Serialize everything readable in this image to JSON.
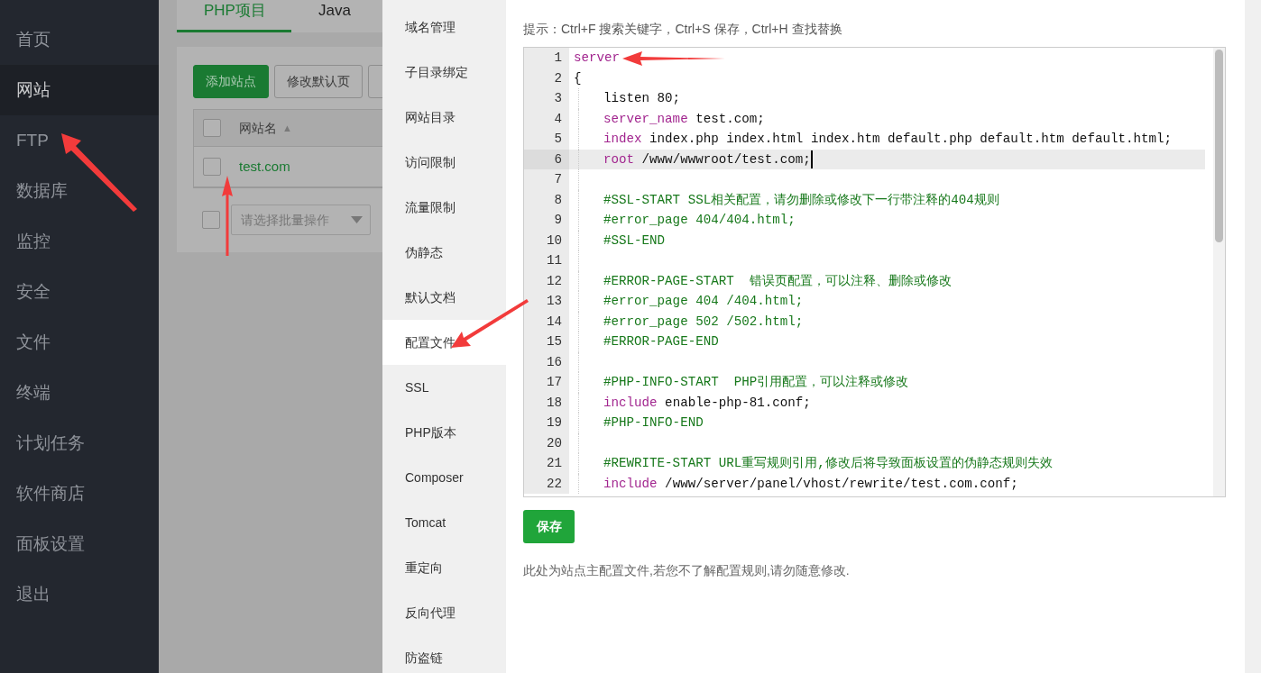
{
  "sidebar": {
    "items": [
      {
        "label": "首页",
        "selected": false
      },
      {
        "label": "网站",
        "selected": true
      },
      {
        "label": "FTP",
        "selected": false
      },
      {
        "label": "数据库",
        "selected": false
      },
      {
        "label": "监控",
        "selected": false
      },
      {
        "label": "安全",
        "selected": false
      },
      {
        "label": "文件",
        "selected": false
      },
      {
        "label": "终端",
        "selected": false
      },
      {
        "label": "计划任务",
        "selected": false
      },
      {
        "label": "软件商店",
        "selected": false
      },
      {
        "label": "面板设置",
        "selected": false
      },
      {
        "label": "退出",
        "selected": false
      }
    ]
  },
  "background_page": {
    "tabs": [
      {
        "label": "PHP项目",
        "selected": true
      },
      {
        "label": "Java",
        "selected": false
      }
    ],
    "buttons": [
      {
        "label": "添加站点",
        "kind": "primary"
      },
      {
        "label": "修改默认页",
        "kind": "outline"
      },
      {
        "kind": "outline"
      }
    ],
    "table": {
      "header": {
        "label": "网站名",
        "sort_arrow": "▲",
        "checked": false
      },
      "rows": [
        {
          "name": "test.com",
          "checked": false
        }
      ]
    },
    "batch_select": {
      "placeholder": "请选择批量操作",
      "checked": false
    }
  },
  "dialog": {
    "menu": [
      {
        "label": "域名管理",
        "selected": false
      },
      {
        "label": "子目录绑定",
        "selected": false
      },
      {
        "label": "网站目录",
        "selected": false
      },
      {
        "label": "访问限制",
        "selected": false
      },
      {
        "label": "流量限制",
        "selected": false
      },
      {
        "label": "伪静态",
        "selected": false
      },
      {
        "label": "默认文档",
        "selected": false
      },
      {
        "label": "配置文件",
        "selected": true
      },
      {
        "label": "SSL",
        "selected": false
      },
      {
        "label": "PHP版本",
        "selected": false
      },
      {
        "label": "Composer",
        "selected": false
      },
      {
        "label": "Tomcat",
        "selected": false
      },
      {
        "label": "重定向",
        "selected": false
      },
      {
        "label": "反向代理",
        "selected": false
      },
      {
        "label": "防盗链",
        "selected": false
      }
    ],
    "hint": "提示：Ctrl+F 搜索关键字，Ctrl+S 保存，Ctrl+H 查找替换",
    "editor": {
      "lines": [
        {
          "number": "1",
          "indented": false,
          "current": false,
          "tokens": [
            {
              "text": "server",
              "kind": "keyword"
            }
          ]
        },
        {
          "number": "2",
          "indented": false,
          "current": false,
          "tokens": [
            {
              "text": "{",
              "kind": "plain"
            }
          ]
        },
        {
          "number": "3",
          "indented": true,
          "current": false,
          "tokens": [
            {
              "text": "listen 80;",
              "kind": "plain"
            }
          ]
        },
        {
          "number": "4",
          "indented": true,
          "current": false,
          "tokens": [
            {
              "text": "server_name",
              "kind": "keyword"
            },
            {
              "text": " test.com;",
              "kind": "plain"
            }
          ]
        },
        {
          "number": "5",
          "indented": true,
          "current": false,
          "tokens": [
            {
              "text": "index",
              "kind": "keyword"
            },
            {
              "text": " index.php index.html index.htm default.php default.htm default.html;",
              "kind": "plain"
            }
          ]
        },
        {
          "number": "6",
          "indented": true,
          "current": true,
          "tokens": [
            {
              "text": "root",
              "kind": "keyword"
            },
            {
              "text": " /www/wwwroot/test.com;",
              "kind": "plain"
            }
          ]
        },
        {
          "number": "7",
          "indented": true,
          "current": false
        },
        {
          "number": "8",
          "indented": true,
          "current": false,
          "tokens": [
            {
              "text": "#SSL-START SSL相关配置，请勿删除或修改下一行带注释的404规则",
              "kind": "comment"
            }
          ]
        },
        {
          "number": "9",
          "indented": true,
          "current": false,
          "tokens": [
            {
              "text": "#error_page 404/404.html;",
              "kind": "comment"
            }
          ]
        },
        {
          "number": "10",
          "indented": true,
          "current": false,
          "tokens": [
            {
              "text": "#SSL-END",
              "kind": "comment"
            }
          ]
        },
        {
          "number": "11",
          "indented": true,
          "current": false
        },
        {
          "number": "12",
          "indented": true,
          "current": false,
          "tokens": [
            {
              "text": "#ERROR-PAGE-START  错误页配置，可以注释、删除或修改",
              "kind": "comment"
            }
          ]
        },
        {
          "number": "13",
          "indented": true,
          "current": false,
          "tokens": [
            {
              "text": "#error_page 404 /404.html;",
              "kind": "comment"
            }
          ]
        },
        {
          "number": "14",
          "indented": true,
          "current": false,
          "tokens": [
            {
              "text": "#error_page 502 /502.html;",
              "kind": "comment"
            }
          ]
        },
        {
          "number": "15",
          "indented": true,
          "current": false,
          "tokens": [
            {
              "text": "#ERROR-PAGE-END",
              "kind": "comment"
            }
          ]
        },
        {
          "number": "16",
          "indented": true,
          "current": false
        },
        {
          "number": "17",
          "indented": true,
          "current": false,
          "tokens": [
            {
              "text": "#PHP-INFO-START  PHP引用配置，可以注释或修改",
              "kind": "comment"
            }
          ]
        },
        {
          "number": "18",
          "indented": true,
          "current": false,
          "tokens": [
            {
              "text": "include",
              "kind": "keyword"
            },
            {
              "text": " enable-php-81.conf;",
              "kind": "plain"
            }
          ]
        },
        {
          "number": "19",
          "indented": true,
          "current": false,
          "tokens": [
            {
              "text": "#PHP-INFO-END",
              "kind": "comment"
            }
          ]
        },
        {
          "number": "20",
          "indented": true,
          "current": false
        },
        {
          "number": "21",
          "indented": true,
          "current": false,
          "tokens": [
            {
              "text": "#REWRITE-START URL重写规则引用,修改后将导致面板设置的伪静态规则失效",
              "kind": "comment"
            }
          ]
        },
        {
          "number": "22",
          "indented": true,
          "current": false,
          "tokens": [
            {
              "text": "include",
              "kind": "keyword"
            },
            {
              "text": " /www/server/panel/vhost/rewrite/test.com.conf;",
              "kind": "plain"
            }
          ]
        }
      ]
    },
    "save_button": "保存",
    "note": "此处为站点主配置文件,若您不了解配置规则,请勿随意修改."
  }
}
